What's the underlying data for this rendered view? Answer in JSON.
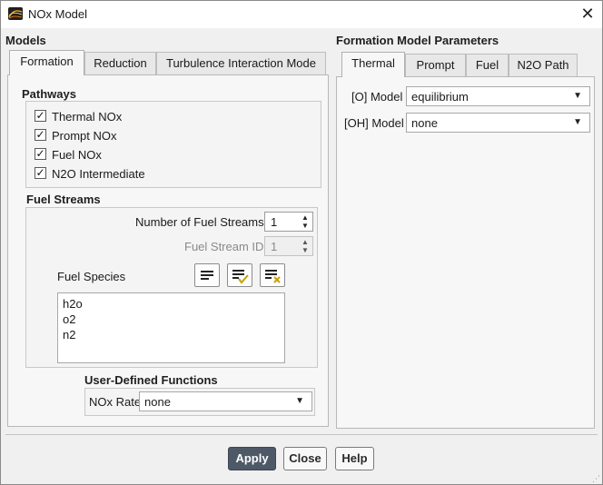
{
  "window": {
    "title": "NOx Model",
    "app_icon": "fluent-app-icon",
    "close_icon": "close-icon"
  },
  "models": {
    "heading": "Models",
    "tabs": [
      {
        "label": "Formation",
        "active": true
      },
      {
        "label": "Reduction",
        "active": false
      },
      {
        "label": "Turbulence Interaction Mode",
        "active": false
      }
    ],
    "pathways": {
      "heading": "Pathways",
      "items": [
        {
          "label": "Thermal NOx",
          "checked": true
        },
        {
          "label": "Prompt NOx",
          "checked": true
        },
        {
          "label": "Fuel NOx",
          "checked": true
        },
        {
          "label": "N2O Intermediate",
          "checked": true
        }
      ],
      "check_mark": "✓"
    },
    "fuel_streams": {
      "heading": "Fuel Streams",
      "num_streams_label": "Number of Fuel Streams",
      "num_streams_value": "1",
      "stream_id_label": "Fuel Stream ID",
      "stream_id_value": "1",
      "species_label": "Fuel Species",
      "species": [
        "h2o",
        "o2",
        "n2"
      ]
    },
    "udf": {
      "heading": "User-Defined Functions",
      "nox_rate_label": "NOx Rate",
      "nox_rate_value": "none"
    }
  },
  "params": {
    "heading": "Formation Model Parameters",
    "tabs": [
      {
        "label": "Thermal",
        "active": true
      },
      {
        "label": "Prompt",
        "active": false
      },
      {
        "label": "Fuel",
        "active": false
      },
      {
        "label": "N2O Path",
        "active": false
      }
    ],
    "o_model_label": "[O] Model",
    "o_model_value": "equilibrium",
    "oh_model_label": "[OH] Model",
    "oh_model_value": "none"
  },
  "buttons": {
    "apply": "Apply",
    "close": "Close",
    "help": "Help"
  },
  "colors": {
    "primary_button": "#4e5968",
    "checkmark_accent": "#c8a000",
    "cross_accent": "#c8a000"
  }
}
